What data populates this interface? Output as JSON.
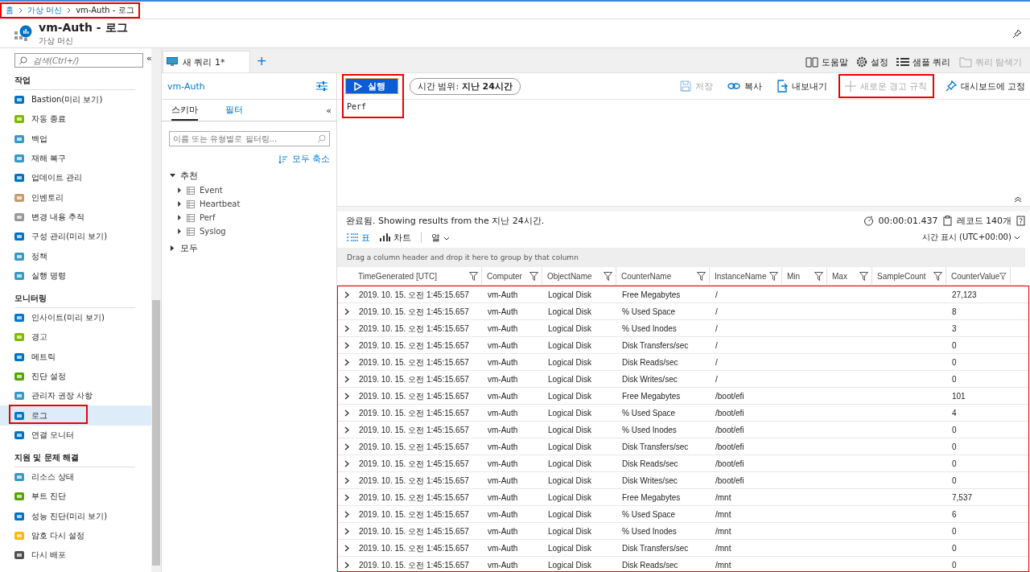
{
  "breadcrumb": {
    "highlighted": true,
    "items": [
      {
        "label": "홈",
        "link": true
      },
      {
        "label": "가상 머신",
        "link": true
      },
      {
        "label": "vm-Auth - 로그",
        "link": false
      }
    ]
  },
  "header": {
    "title": "vm-Auth - 로그",
    "subtitle": "가상 머신"
  },
  "sidebar": {
    "search": {
      "placeholder": "검색(Ctrl+/)"
    },
    "collapse": "«",
    "sections": [
      {
        "title": "작업",
        "items": [
          {
            "label": "Bastion(미리 보기)",
            "selected": false,
            "highlighted": false
          },
          {
            "label": "자동 종료",
            "selected": false,
            "highlighted": false
          },
          {
            "label": "백업",
            "selected": false,
            "highlighted": false
          },
          {
            "label": "재해 복구",
            "selected": false,
            "highlighted": false
          },
          {
            "label": "업데이트 관리",
            "selected": false,
            "highlighted": false
          },
          {
            "label": "인벤토리",
            "selected": false,
            "highlighted": false
          },
          {
            "label": "변경 내용 추적",
            "selected": false,
            "highlighted": false
          },
          {
            "label": "구성 관리(미리 보기)",
            "selected": false,
            "highlighted": false
          },
          {
            "label": "정책",
            "selected": false,
            "highlighted": false
          },
          {
            "label": "실행 명령",
            "selected": false,
            "highlighted": false
          }
        ]
      },
      {
        "title": "모니터링",
        "items": [
          {
            "label": "인사이트(미리 보기)",
            "selected": false,
            "highlighted": false
          },
          {
            "label": "경고",
            "selected": false,
            "highlighted": false
          },
          {
            "label": "메트릭",
            "selected": false,
            "highlighted": false
          },
          {
            "label": "진단 설정",
            "selected": false,
            "highlighted": false
          },
          {
            "label": "관리자 권장 사항",
            "selected": false,
            "highlighted": false
          },
          {
            "label": "로그",
            "selected": true,
            "highlighted": true
          },
          {
            "label": "연결 모니터",
            "selected": false,
            "highlighted": false
          }
        ]
      },
      {
        "title": "지원 및 문제 해결",
        "items": [
          {
            "label": "리소스 상태",
            "selected": false,
            "highlighted": false
          },
          {
            "label": "부트 진단",
            "selected": false,
            "highlighted": false
          },
          {
            "label": "성능 진단(미리 보기)",
            "selected": false,
            "highlighted": false
          },
          {
            "label": "암호 다시 설정",
            "selected": false,
            "highlighted": false
          },
          {
            "label": "다시 배포",
            "selected": false,
            "highlighted": false
          }
        ]
      }
    ]
  },
  "query_tabs": [
    {
      "label": "새 쿼리 1*",
      "selected": true
    }
  ],
  "add_tab": "+",
  "top_toolbar": [
    {
      "label": "도움말",
      "disabled": false
    },
    {
      "label": "설정",
      "disabled": false
    },
    {
      "label": "샘플 쿼리",
      "disabled": false
    },
    {
      "label": "쿼리 탐색기",
      "disabled": true
    }
  ],
  "schema_panel": {
    "scope": "vm-Auth",
    "tabs": [
      {
        "label": "스키마",
        "selected": true
      },
      {
        "label": "필터",
        "selected": false
      }
    ],
    "collapse": "«",
    "filter": {
      "placeholder": "이름 또는 유형별로 필터링..."
    },
    "collapse_all": "모두 축소",
    "tree": [
      {
        "label": "추천",
        "expanded": true,
        "children": [
          {
            "label": "Event",
            "expanded": false
          },
          {
            "label": "Heartbeat",
            "expanded": false
          },
          {
            "label": "Perf",
            "expanded": false
          },
          {
            "label": "Syslog",
            "expanded": false
          }
        ]
      },
      {
        "label": "모두",
        "expanded": false
      }
    ]
  },
  "query_toolbar": {
    "run": {
      "label": "실행",
      "highlighted": true
    },
    "time_range": {
      "label": "시간 범위:",
      "value": "지난 24시간"
    },
    "actions": [
      {
        "label": "저장",
        "disabled": true,
        "highlighted": false
      },
      {
        "label": "복사",
        "disabled": false,
        "highlighted": false
      },
      {
        "label": "내보내기",
        "disabled": false,
        "highlighted": false
      },
      {
        "label": "새로운 경고 규칙",
        "disabled": true,
        "highlighted": true
      },
      {
        "label": "대시보드에 고정",
        "disabled": false,
        "highlighted": false
      }
    ]
  },
  "editor": {
    "value": "Perf"
  },
  "results": {
    "status": "완료됨. Showing results from the 지난 24시간.",
    "duration": "00:00:01.437",
    "records": "레코드 140개",
    "view_tabs": [
      {
        "label": "표",
        "selected": true
      },
      {
        "label": "차트",
        "selected": false
      }
    ],
    "columns_menu": "열",
    "time_display": "시간 표시 (UTC+00:00)",
    "group_hint": "Drag a column header and drop it here to group by that column",
    "highlighted": true,
    "columns": [
      "TimeGenerated [UTC]",
      "Computer",
      "ObjectName",
      "CounterName",
      "InstanceName",
      "Min",
      "Max",
      "SampleCount",
      "CounterValue"
    ],
    "rows": [
      [
        "2019. 10. 15. 오전 1:45:15.657",
        "vm-Auth",
        "Logical Disk",
        "Free Megabytes",
        "/",
        "",
        "",
        "",
        "27,123"
      ],
      [
        "2019. 10. 15. 오전 1:45:15.657",
        "vm-Auth",
        "Logical Disk",
        "% Used Space",
        "/",
        "",
        "",
        "",
        "8"
      ],
      [
        "2019. 10. 15. 오전 1:45:15.657",
        "vm-Auth",
        "Logical Disk",
        "% Used Inodes",
        "/",
        "",
        "",
        "",
        "3"
      ],
      [
        "2019. 10. 15. 오전 1:45:15.657",
        "vm-Auth",
        "Logical Disk",
        "Disk Transfers/sec",
        "/",
        "",
        "",
        "",
        "0"
      ],
      [
        "2019. 10. 15. 오전 1:45:15.657",
        "vm-Auth",
        "Logical Disk",
        "Disk Reads/sec",
        "/",
        "",
        "",
        "",
        "0"
      ],
      [
        "2019. 10. 15. 오전 1:45:15.657",
        "vm-Auth",
        "Logical Disk",
        "Disk Writes/sec",
        "/",
        "",
        "",
        "",
        "0"
      ],
      [
        "2019. 10. 15. 오전 1:45:15.657",
        "vm-Auth",
        "Logical Disk",
        "Free Megabytes",
        "/boot/efi",
        "",
        "",
        "",
        "101"
      ],
      [
        "2019. 10. 15. 오전 1:45:15.657",
        "vm-Auth",
        "Logical Disk",
        "% Used Space",
        "/boot/efi",
        "",
        "",
        "",
        "4"
      ],
      [
        "2019. 10. 15. 오전 1:45:15.657",
        "vm-Auth",
        "Logical Disk",
        "% Used Inodes",
        "/boot/efi",
        "",
        "",
        "",
        "0"
      ],
      [
        "2019. 10. 15. 오전 1:45:15.657",
        "vm-Auth",
        "Logical Disk",
        "Disk Transfers/sec",
        "/boot/efi",
        "",
        "",
        "",
        "0"
      ],
      [
        "2019. 10. 15. 오전 1:45:15.657",
        "vm-Auth",
        "Logical Disk",
        "Disk Reads/sec",
        "/boot/efi",
        "",
        "",
        "",
        "0"
      ],
      [
        "2019. 10. 15. 오전 1:45:15.657",
        "vm-Auth",
        "Logical Disk",
        "Disk Writes/sec",
        "/boot/efi",
        "",
        "",
        "",
        "0"
      ],
      [
        "2019. 10. 15. 오전 1:45:15.657",
        "vm-Auth",
        "Logical Disk",
        "Free Megabytes",
        "/mnt",
        "",
        "",
        "",
        "7,537"
      ],
      [
        "2019. 10. 15. 오전 1:45:15.657",
        "vm-Auth",
        "Logical Disk",
        "% Used Space",
        "/mnt",
        "",
        "",
        "",
        "6"
      ],
      [
        "2019. 10. 15. 오전 1:45:15.657",
        "vm-Auth",
        "Logical Disk",
        "% Used Inodes",
        "/mnt",
        "",
        "",
        "",
        "0"
      ],
      [
        "2019. 10. 15. 오전 1:45:15.657",
        "vm-Auth",
        "Logical Disk",
        "Disk Transfers/sec",
        "/mnt",
        "",
        "",
        "",
        "0"
      ],
      [
        "2019. 10. 15. 오전 1:45:15.657",
        "vm-Auth",
        "Logical Disk",
        "Disk Reads/sec",
        "/mnt",
        "",
        "",
        "",
        "0"
      ]
    ]
  }
}
